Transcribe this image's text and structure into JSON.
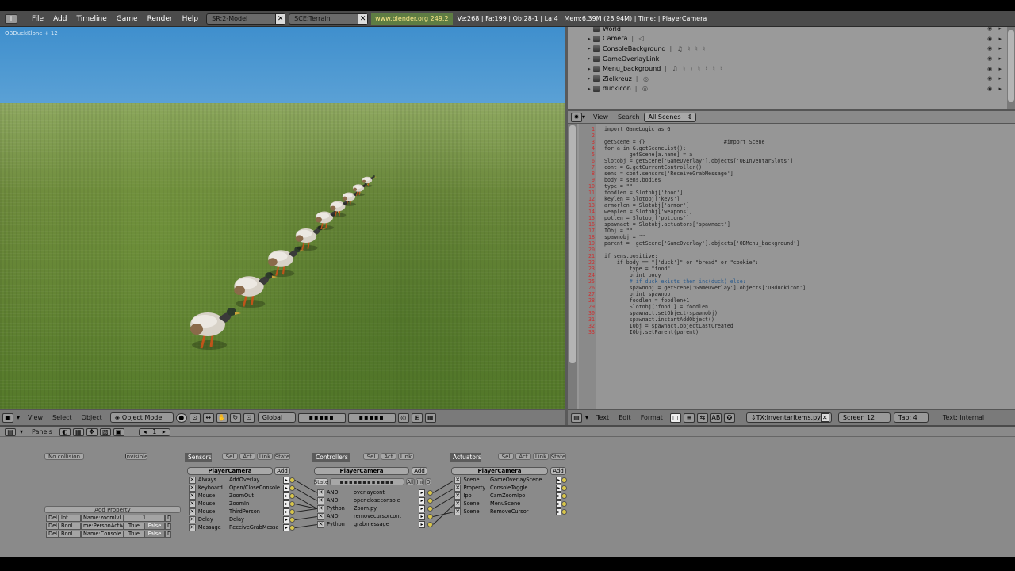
{
  "colors": {
    "sky": "#5ea6db",
    "grass": "#6d8a3c",
    "url_bg": "#5e7d43",
    "url_text": "#ffea8a"
  },
  "topbar": {
    "menus": [
      "File",
      "Add",
      "Timeline",
      "Game",
      "Render",
      "Help"
    ],
    "screen_field": "SR:2-Model",
    "scene_field": "SCE:Terrain",
    "url": "www.blender.org 249.2",
    "stats": "Ve:268 | Fa:199 | Ob:28-1 | La:4  | Mem:6.39M (28.94M)  | Time: | PlayerCamera"
  },
  "viewport": {
    "label": "OBDuckKlone + 12"
  },
  "outliner": {
    "items": [
      {
        "name": "World",
        "extras": ""
      },
      {
        "name": "Camera",
        "extras": "|  ◁"
      },
      {
        "name": "ConsoleBackground",
        "extras": "|  ♫ ♮ ♮ ♮"
      },
      {
        "name": "GameOverlayLink",
        "extras": ""
      },
      {
        "name": "Menu_background",
        "extras": "|  ♫ ♮ ♮ ♮ ♮ ♮ ♮"
      },
      {
        "name": "Zielkreuz",
        "extras": "|  ◎"
      },
      {
        "name": "duckicon",
        "extras": "|  ◎"
      }
    ]
  },
  "text_header": {
    "menus": [
      "View",
      "Search"
    ],
    "scope": "All Scenes"
  },
  "code": [
    {
      "n": "1",
      "t": "import GameLogic as G"
    },
    {
      "n": "2",
      "t": ""
    },
    {
      "n": "3",
      "t": "getScene = {}                         #import Scene"
    },
    {
      "n": "4",
      "t": "for a in G.getSceneList():"
    },
    {
      "n": "5",
      "t": "        getScene[a.name] = a"
    },
    {
      "n": "6",
      "t": "Slotobj = getScene['GameOverlay'].objects['OBInventarSlots']"
    },
    {
      "n": "7",
      "t": "cont = G.getCurrentController()"
    },
    {
      "n": "8",
      "t": "sens = cont.sensors['ReceiveGrabMessage']"
    },
    {
      "n": "9",
      "t": "body = sens.bodies"
    },
    {
      "n": "10",
      "t": "type = \"\""
    },
    {
      "n": "11",
      "t": "foodlen = Slotobj['food']"
    },
    {
      "n": "12",
      "t": "keylen = Slotobj['keys']"
    },
    {
      "n": "13",
      "t": "armorlen = Slotobj['armor']"
    },
    {
      "n": "14",
      "t": "weaplen = Slotobj['weapons']"
    },
    {
      "n": "15",
      "t": "potlen = Slotobj['potions']"
    },
    {
      "n": "16",
      "t": "spawnact = Slotobj.actuators['spawnact']"
    },
    {
      "n": "17",
      "t": "IObj = \"\""
    },
    {
      "n": "18",
      "t": "spawnobj = \"\""
    },
    {
      "n": "19",
      "t": "parent =  getScene['GameOverlay'].objects['OBMenu_background']"
    },
    {
      "n": "20",
      "t": ""
    },
    {
      "n": "21",
      "t": "if sens.positive:"
    },
    {
      "n": "22",
      "t": "    if body == \"['duck']\" or \"bread\" or \"cookie\":"
    },
    {
      "n": "23",
      "t": "        type = \"food\""
    },
    {
      "n": "24",
      "t": "        print body"
    },
    {
      "n": "25",
      "t": "        # if duck exists then inc(duck) else:"
    },
    {
      "n": "26",
      "t": "        spawnobj = getScene['GameOverlay'].objects['OBduckicon']"
    },
    {
      "n": "27",
      "t": "        print spawnobj"
    },
    {
      "n": "28",
      "t": "        foodlen = foodlen+1"
    },
    {
      "n": "29",
      "t": "        Slotobj['food'] = foodlen"
    },
    {
      "n": "30",
      "t": "        spawnact.setObject(spawnobj)"
    },
    {
      "n": "31",
      "t": "        spawnact.instantAddObject()"
    },
    {
      "n": "32",
      "t": "        IObj = spawnact.objectLastCreated"
    },
    {
      "n": "33",
      "t": "        IObj.setParent(parent)"
    }
  ],
  "viewport_footer": {
    "menus": [
      "View",
      "Select",
      "Object"
    ],
    "mode": "Object Mode",
    "orientation": "Global"
  },
  "text_footer": {
    "menus": [
      "Text",
      "Edit",
      "Format"
    ],
    "file": "TX:InventarItems.py",
    "screen": "Screen 12",
    "tab": "Tab: 4",
    "type": "Text: Internal"
  },
  "logic": {
    "panels_label": "Panels",
    "frame": "1",
    "no_collision": "No collision",
    "invisible": "Invisible",
    "add_property": "Add Property",
    "properties": [
      {
        "del": "Del",
        "type": "Int",
        "name": "Name:zoomlvl",
        "val": "1",
        "d": "D"
      },
      {
        "del": "Del",
        "type": "Bool",
        "name": "me:PersonActive",
        "val": "True",
        "f": "False",
        "d": "D"
      },
      {
        "del": "Del",
        "type": "Bool",
        "name": "Name:Console",
        "val": "True",
        "f": "False",
        "d": "D"
      }
    ],
    "sensors": {
      "title": "Sensors",
      "tabs": [
        "Sel",
        "Act",
        "Link",
        "State"
      ],
      "object": "PlayerCamera",
      "add": "Add",
      "bricks": [
        {
          "type": "Always",
          "name": "AddOverlay"
        },
        {
          "type": "Keyboard",
          "name": "Open/CloseConsole"
        },
        {
          "type": "Mouse",
          "name": "ZoomOut"
        },
        {
          "type": "Mouse",
          "name": "ZoomIn"
        },
        {
          "type": "Mouse",
          "name": "ThirdPerson"
        },
        {
          "type": "Delay",
          "name": "Delay"
        },
        {
          "type": "Message",
          "name": "ReceiveGrabMessa"
        }
      ]
    },
    "controllers": {
      "title": "Controllers",
      "tabs": [
        "Sel",
        "Act",
        "Link"
      ],
      "object": "PlayerCamera",
      "add": "Add",
      "state_label": "State",
      "all": "All",
      "ini": "Ini",
      "d": "D",
      "bricks": [
        {
          "type": "AND",
          "name": "overlaycont"
        },
        {
          "type": "AND",
          "name": "opencloseconsole"
        },
        {
          "type": "Python",
          "name": "Zoom.py"
        },
        {
          "type": "AND",
          "name": "removecursorcont"
        },
        {
          "type": "Python",
          "name": "grabmessage"
        }
      ]
    },
    "actuators": {
      "title": "Actuators",
      "tabs": [
        "Sel",
        "Act",
        "Link",
        "State"
      ],
      "object": "PlayerCamera",
      "add": "Add",
      "bricks": [
        {
          "type": "Scene",
          "name": "GameOverlayScene"
        },
        {
          "type": "Property",
          "name": "ConsoleToggle"
        },
        {
          "type": "Ipo",
          "name": "CamZoomIpo"
        },
        {
          "type": "Scene",
          "name": "MenuScene"
        },
        {
          "type": "Scene",
          "name": "RemoveCursor"
        }
      ]
    }
  }
}
